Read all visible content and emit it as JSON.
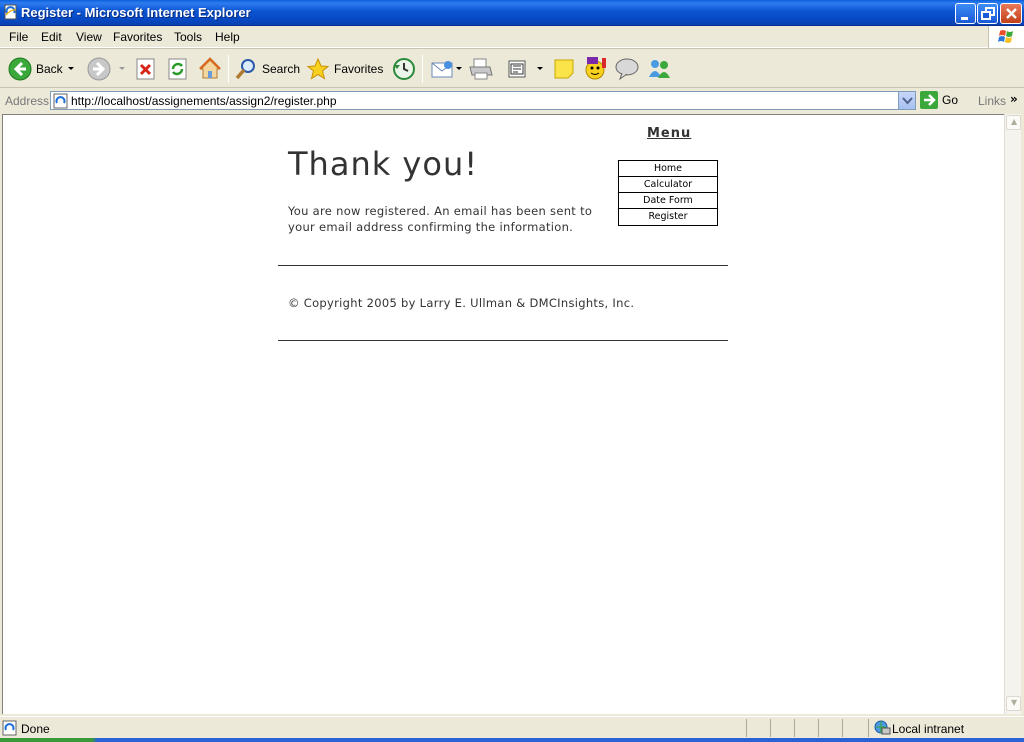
{
  "window": {
    "title": "Register - Microsoft Internet Explorer"
  },
  "menubar": {
    "items": [
      "File",
      "Edit",
      "View",
      "Favorites",
      "Tools",
      "Help"
    ]
  },
  "toolbar": {
    "back_label": "Back",
    "search_label": "Search",
    "favorites_label": "Favorites"
  },
  "address": {
    "label": "Address",
    "url": "http://localhost/assignements/assign2/register.php",
    "go_label": "Go",
    "links_label": "Links"
  },
  "page": {
    "heading": "Thank you!",
    "message": "You are now registered. An email has been sent to your email address confirming the information.",
    "menu_title": "Menu",
    "menu_items": [
      "Home",
      "Calculator",
      "Date Form",
      "Register"
    ],
    "copyright": "© Copyright 2005 by Larry E. Ullman & DMCInsights, Inc."
  },
  "status": {
    "text": "Done",
    "zone": "Local intranet"
  },
  "colors": {
    "titlebar": "#0a54d2",
    "chrome": "#ece9d8",
    "page_text": "#333333"
  }
}
